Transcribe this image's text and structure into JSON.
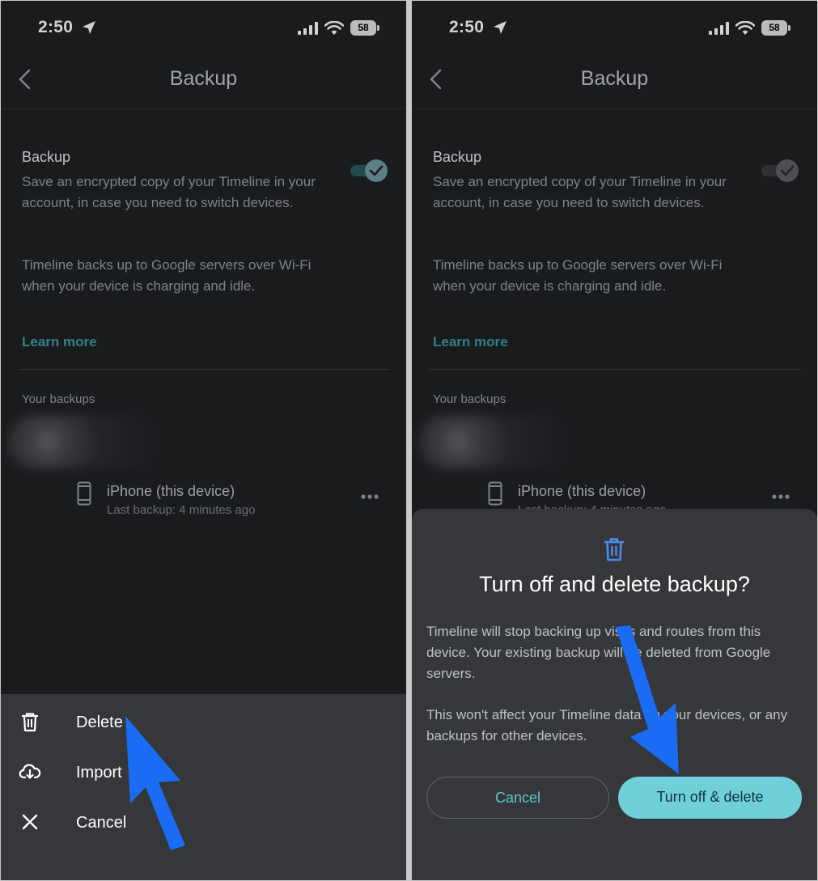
{
  "status": {
    "time": "2:50",
    "battery": "58"
  },
  "app_bar": {
    "title": "Backup"
  },
  "backup": {
    "title": "Backup",
    "description": "Save an encrypted copy of your Timeline in your account, in case you need to switch devices.",
    "description2": "Timeline backs up to Google servers over Wi-Fi when your device is charging and idle.",
    "learn_more": "Learn more"
  },
  "backups_section": {
    "label": "Your backups",
    "device_name": "iPhone (this device)",
    "last_backup": "Last backup: 4 minutes ago"
  },
  "action_sheet": {
    "delete": "Delete",
    "import": "Import",
    "cancel": "Cancel"
  },
  "dialog": {
    "title": "Turn off and delete backup?",
    "body1": "Timeline will stop backing up visits and routes from this device. Your existing backup will be deleted from Google servers.",
    "body2": "This won't affect your Timeline data on your devices, or any backups for other devices.",
    "cancel": "Cancel",
    "confirm": "Turn off & delete"
  },
  "colors": {
    "background": "#202124",
    "sheet": "#36373a",
    "accent": "#6fd0d9",
    "link": "#3f9ea6",
    "annotation_arrow": "#1a6cf5"
  }
}
